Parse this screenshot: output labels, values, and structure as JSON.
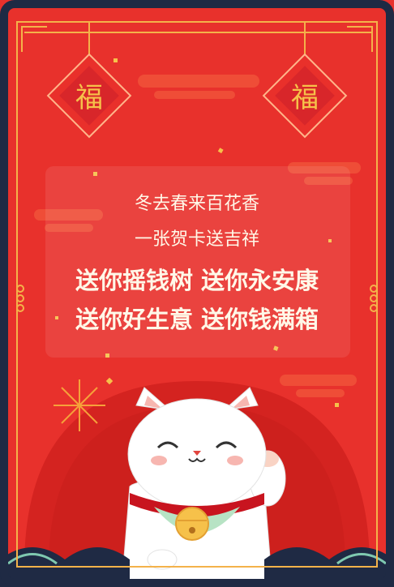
{
  "greeting": {
    "line1": "冬去春来百花香",
    "line2": "一张贺卡送吉祥",
    "line3": "送你摇钱树  送你永安康",
    "line4": "送你好生意  送你钱满箱"
  },
  "lantern_char": "福",
  "colors": {
    "background": "#e8312c",
    "frame": "#1f2a44",
    "gold": "#f4b24a",
    "text": "#fff8e8"
  }
}
